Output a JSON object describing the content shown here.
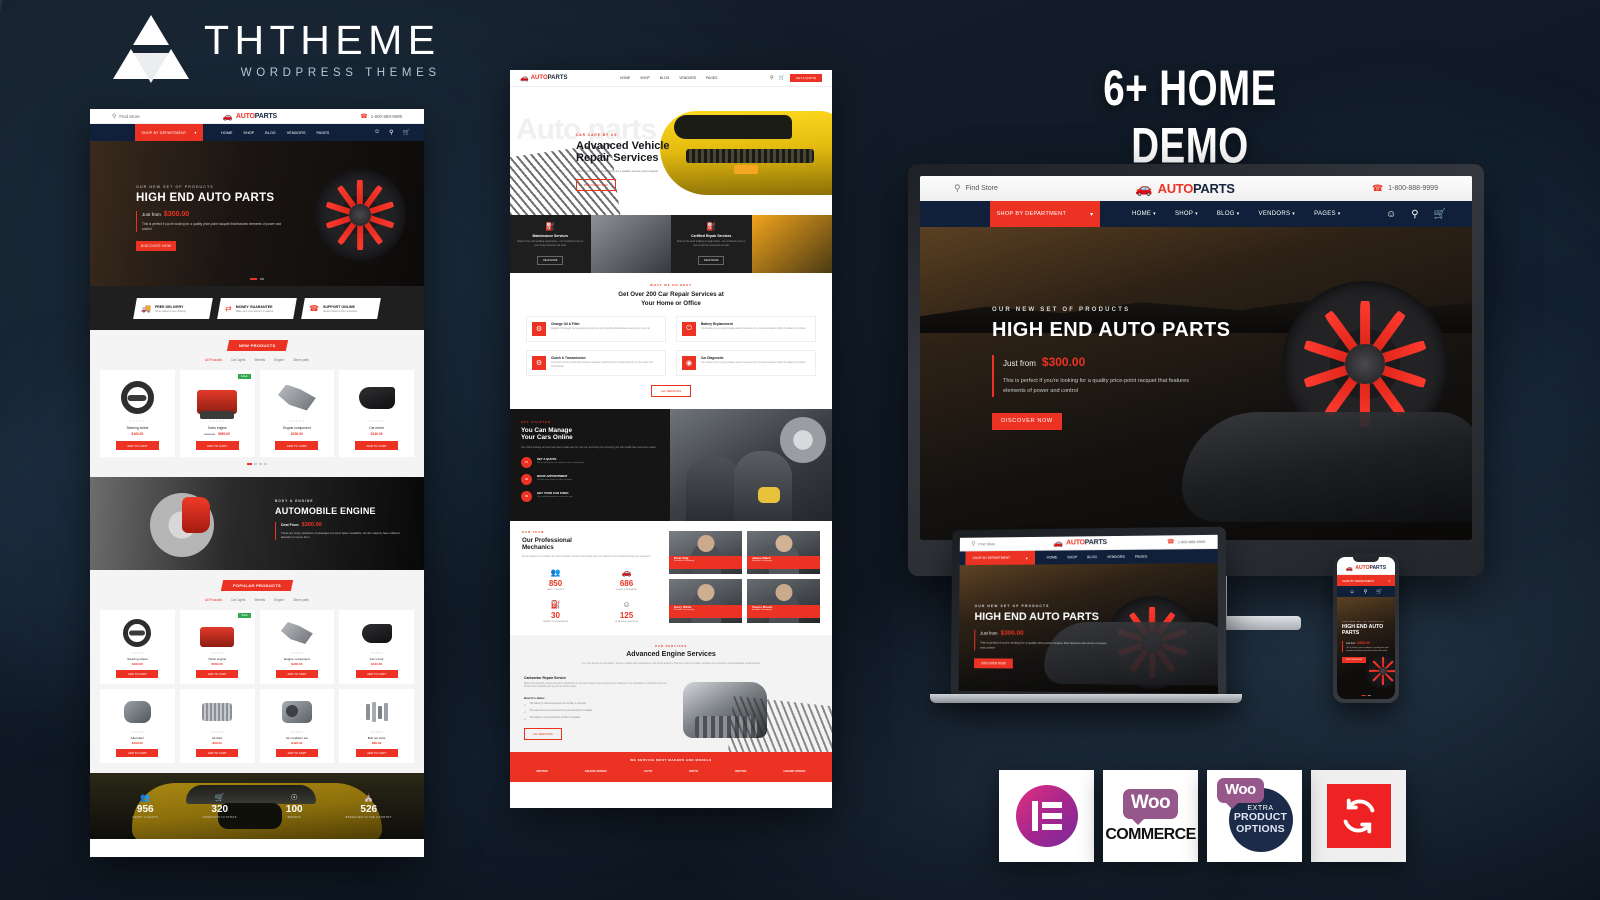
{
  "poster": {
    "brand": {
      "name": "THTHEME",
      "tagline": "WORDPRESS THEMES",
      "logo_icon": "triforce-triangle-logo"
    },
    "headline": "6+ HOME DEMO",
    "background_color": "#101a26",
    "accent_color": "#ec3323"
  },
  "site": {
    "logo_text_1": "AUTO",
    "logo_text_2": "PARTS",
    "logo_icon": "car-front-icon",
    "topbar": {
      "find_store": "Find Store",
      "find_store_icon": "map-pin-icon",
      "phone": "1-800-888-9999",
      "phone_icon": "phone-icon"
    },
    "nav": {
      "department_label": "SHOP BY DEPARTMENT",
      "department_icon": "chevron-down-icon",
      "links": [
        "HOME",
        "SHOP",
        "BLOG",
        "VENDORS",
        "PAGES"
      ],
      "account_icon": "user-icon",
      "search_icon": "search-icon",
      "cart_icon": "cart-icon",
      "cart_count": "0"
    },
    "hero": {
      "eyebrow": "OUR NEW SET OF PRODUCTS",
      "title": "HIGH END AUTO PARTS",
      "price_label": "Just from",
      "price": "$300.00",
      "description": "This is perfect if you're looking for a quality price-point racquet that features elements of power and control",
      "cta": "DISCOVER NOW"
    },
    "features": [
      {
        "icon": "truck-icon",
        "title": "FREE DELIVERY",
        "subtitle": "Home delivery free shipping"
      },
      {
        "icon": "exchange-icon",
        "title": "MONEY GUARANTEE",
        "subtitle": "Make sure your delivery is always"
      },
      {
        "icon": "headset-icon",
        "title": "SUPPORT ONLINE",
        "subtitle": "Always failed to your questions"
      }
    ],
    "new_products": {
      "badge": "NEW PRODUCTS",
      "tabs": [
        "All Products",
        "Car Lights",
        "Wheels",
        "Engine",
        "Other parts"
      ],
      "items": [
        {
          "name": "Steering wheel",
          "price": "$160.00",
          "image": "steering-wheel",
          "badge": "",
          "button": "ADD TO CART",
          "rating": 5
        },
        {
          "name": "Turbo engine",
          "price": "$560.00",
          "old_price": "$700.00",
          "image": "red-engine",
          "badge": "SALE",
          "button": "ADD TO CART",
          "rating": 5
        },
        {
          "name": "Engine component",
          "price": "$230.00",
          "image": "suspension-parts",
          "badge": "",
          "button": "ADD TO CART",
          "rating": 5
        },
        {
          "name": "Car mirror",
          "price": "$140.00",
          "image": "car-mirror",
          "badge": "",
          "button": "ADD TO CART",
          "rating": 5
        }
      ]
    },
    "engine_banner": {
      "eyebrow": "BODY & ENGINE",
      "title": "AUTOMOBILE ENGINE",
      "price_label": "Deal From",
      "price": "$300.00",
      "description": "There are many variations of passages of Lorem Ipsum available, but the majority have suffered alteration in some form"
    },
    "popular_products": {
      "badge": "POPULAR PRODUCTS",
      "tabs": [
        "All Products",
        "Car Lights",
        "Wheels",
        "Engine",
        "Other parts"
      ],
      "items": [
        {
          "name": "Steering wheel",
          "price": "$160.00",
          "image": "steering-wheel",
          "badge": "",
          "button": "ADD TO CART"
        },
        {
          "name": "Turbo engine",
          "price": "$560.00",
          "image": "red-engine",
          "badge": "SALE",
          "button": "ADD TO CART"
        },
        {
          "name": "Engine component",
          "price": "$230.00",
          "image": "suspension-parts",
          "badge": "",
          "button": "ADD TO CART"
        },
        {
          "name": "Car mirror",
          "price": "$140.00",
          "image": "car-mirror",
          "badge": "",
          "button": "ADD TO CART"
        },
        {
          "name": "Alternator",
          "price": "$190.00",
          "image": "alternator",
          "badge": "",
          "button": "ADD TO CART"
        },
        {
          "name": "Air filter",
          "price": "$60.00",
          "image": "air-filter",
          "badge": "",
          "button": "ADD TO CART"
        },
        {
          "name": "Air condition set",
          "price": "$420.00",
          "image": "ac-compressor",
          "badge": "",
          "button": "ADD TO CART"
        },
        {
          "name": "Bolt set tools",
          "price": "$80.00",
          "image": "bolt-set",
          "badge": "",
          "button": "ADD TO CART"
        }
      ]
    },
    "counters": [
      {
        "icon": "people-icon",
        "value": "956",
        "label": "HAPPY CLIENTS"
      },
      {
        "icon": "cart-icon",
        "value": "320",
        "label": "PRODUCTS IN STOCK"
      },
      {
        "icon": "headset-icon",
        "value": "100",
        "label": "BRANDS"
      },
      {
        "icon": "store-icon",
        "value": "526",
        "label": "BRANCHES IN THE COUNTRY"
      }
    ]
  },
  "service_page": {
    "nav": {
      "links": [
        "HOME",
        "SHOP",
        "BLOG",
        "VENDORS",
        "PAGES"
      ],
      "search_icon": "search-icon",
      "cart_icon": "cart-icon",
      "cta": "GET A QUOTE"
    },
    "hero": {
      "watermark": "Auto parts",
      "eyebrow": "CAR CARE BY US",
      "title_line1": "Advanced Vehicle",
      "title_line2": "Repair Services",
      "description": "This is perfect if you're looking for a quality service point racquet",
      "cta": "DISCOVER NOW"
    },
    "service_tiles": [
      {
        "icon": "oil-can-icon",
        "title": "Maintenance Services",
        "text": "Read on the most auditing repair shops - our mechanics come to your fixing convenient car team",
        "cta": "READ MORE"
      },
      {
        "icon": "fuel-icon",
        "title": "Certified Repair Services",
        "text": "Read on the most auditing at repair shops - our mechanics come to your of your be convenient car team",
        "cta": "READ MORE"
      }
    ],
    "services_block": {
      "eyebrow": "WHAT WE DO BEST",
      "title_line1": "Get Over 200 Car Repair Services at",
      "title_line2": "Your Home or Office",
      "items": [
        {
          "icon": "oil-filter-icon",
          "title": "Change Oil & Filter",
          "text": "Regular oil changes can generally contains the most important fluid between services for your car"
        },
        {
          "icon": "battery-icon",
          "title": "Battery Replacement",
          "text": "Your battery is an energy storage device that relies on a chemical reaction within the battery to produce"
        },
        {
          "icon": "gear-icon",
          "title": "Clutch & Transmission",
          "text": "The Clutch set is a clutch that involves mechanic powerful points of either kind of it in your basic and transmission"
        },
        {
          "icon": "diagnostic-icon",
          "title": "Car Diagnostic",
          "text": "Your battery is an energy storage device that relies on a chemical reaction within the battery to produce"
        }
      ],
      "cta": "ALL SERVICES"
    },
    "manage_block": {
      "eyebrow": "GET STARTED",
      "title_line1": "You Can Manage",
      "title_line2": "Your Cars Online",
      "description": "Our online booking services have been made easy for your car, and book your servicing your cars health has never been easier",
      "steps": [
        {
          "number": "01",
          "title": "SET A QUOTE",
          "text": "Tell us what your car needs or select a diagnostic"
        },
        {
          "number": "02",
          "title": "BOOK APPOINTMENT",
          "text": "Provide your home or office location"
        },
        {
          "number": "03",
          "title": "GET YOUR CAR FIXED",
          "text": "Our certified mechanic comes to you"
        }
      ]
    },
    "mechanics_block": {
      "eyebrow": "OUR TEAM",
      "title_line1": "Our Professional",
      "title_line2": "Mechanics",
      "description": "We are always on to deliver the best mechanic services and repair your car, based in the and that services you requested",
      "stats": [
        {
          "icon": "people-icon",
          "value": "850",
          "label": "HAPPY CLIENTS"
        },
        {
          "icon": "car-icon",
          "value": "686",
          "label": "VEHICLE REPAIRED"
        },
        {
          "icon": "oil-can-icon",
          "value": "30",
          "label": "YEARS OF EXPERIENCE"
        },
        {
          "icon": "team-icon",
          "value": "125",
          "label": "QUALIFIED SERVICES"
        }
      ],
      "team": [
        {
          "name": "Peter Kilg",
          "role": "Founder of company"
        },
        {
          "name": "James Black",
          "role": "Founder of company"
        },
        {
          "name": "Harry White",
          "role": "Founder of company"
        },
        {
          "name": "Tomos Brown",
          "role": "Founder of company"
        }
      ]
    },
    "engine_services": {
      "eyebrow": "OUR SERVICES",
      "title": "Advanced Engine Services",
      "description": "For your car we do everything - service, repairs and maintenance. We do the author to choose to them our team, because our experience and knowledge is well worked",
      "sub_title": "Carburetor Repair Service",
      "sub_text": "Before fuel injection systems became mainstream the car had a device was controlled by a carburetor. It is noticeable or important at the top of that chain manifold, and we look at and fuel ratio.",
      "how_title": "How it's done:",
      "how_items": [
        "The battery is disconnected and the air filter is removed",
        "The carburetor is removed and the new carburetor is installed",
        "The battery is reconnected the air filter is installed"
      ],
      "cta": "ALL SERVICES"
    },
    "brands_strip": {
      "title": "WE SERVICE MOST MAKERS AND MODELS",
      "brands": [
        "MOTOR",
        "GRAND SPEED",
        "AUTO",
        "MOTO",
        "MOTOR",
        "GRAND SPEED"
      ]
    }
  },
  "plugins": [
    {
      "name": "Elementor",
      "icon": "elementor-icon"
    },
    {
      "name": "WooCommerce",
      "word1": "Woo",
      "word2": "COMMERCE",
      "icon": "woocommerce-icon"
    },
    {
      "name": "Woo Extra Product Options",
      "word1": "Woo",
      "line1": "EXTRA",
      "line2": "PRODUCT",
      "line3": "OPTIONS",
      "icon": "woo-epo-icon"
    },
    {
      "name": "WPML / Sync",
      "icon": "sync-refresh-icon"
    }
  ]
}
